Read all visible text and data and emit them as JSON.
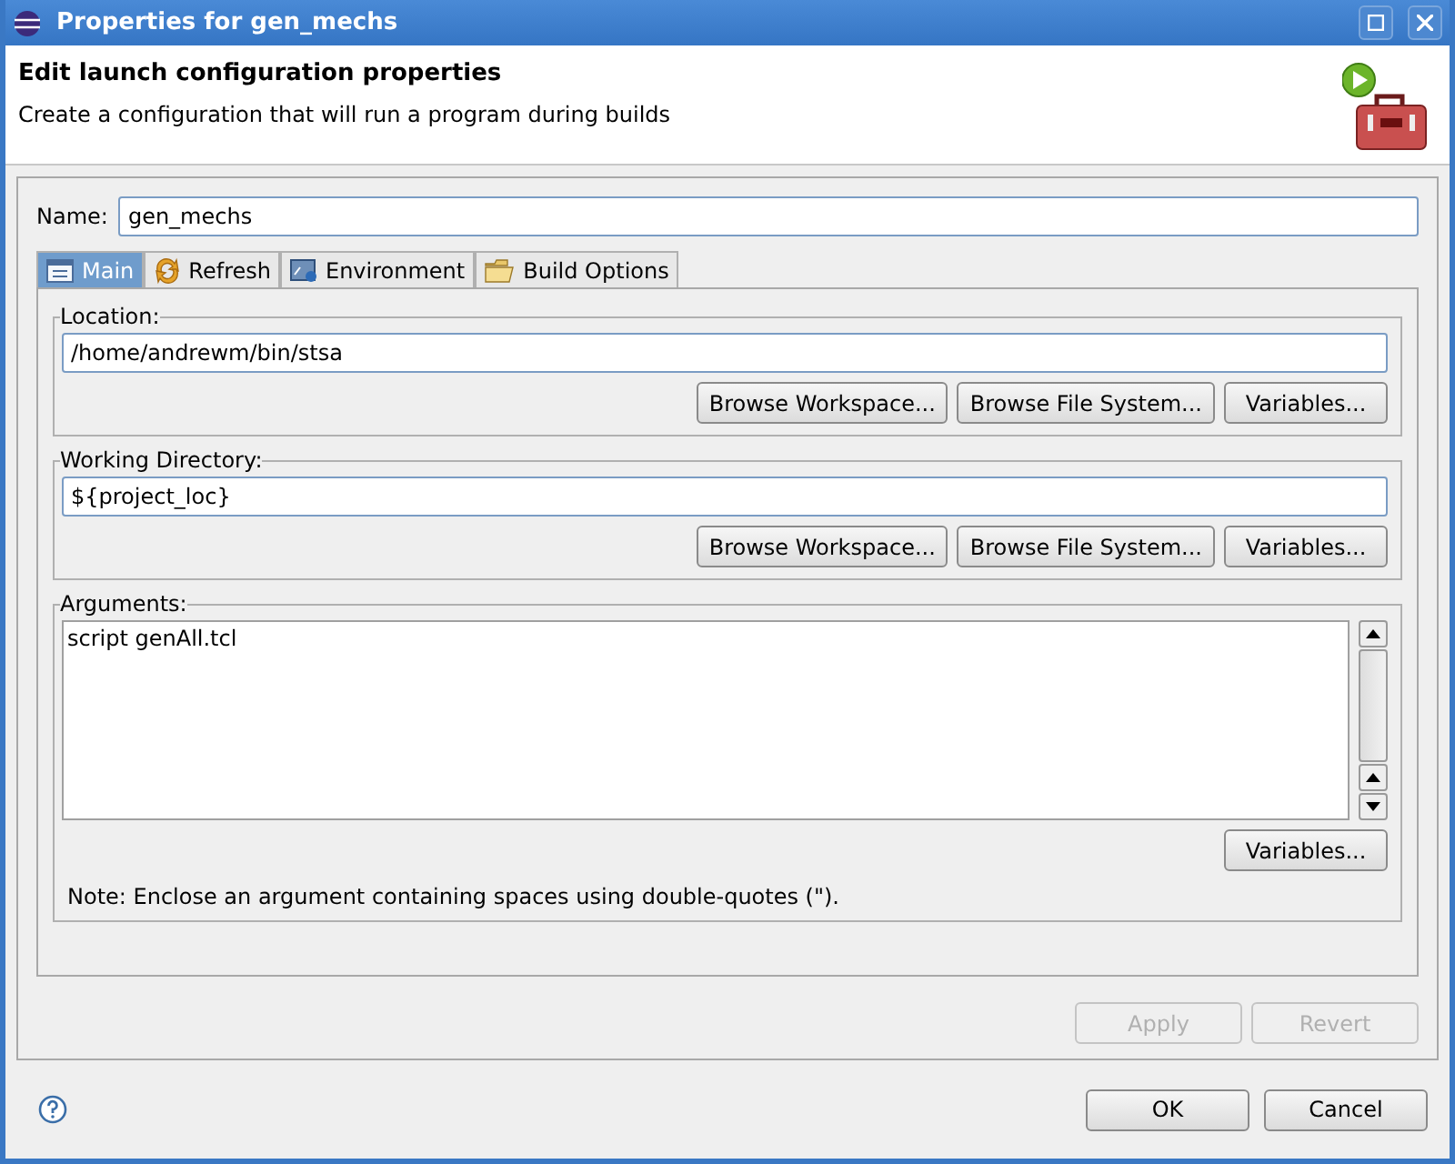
{
  "window": {
    "title": "Properties for gen_mechs"
  },
  "header": {
    "title": "Edit launch configuration properties",
    "description": "Create a configuration that will run a program during builds"
  },
  "name_field": {
    "label": "Name:",
    "value": "gen_mechs"
  },
  "tabs": [
    {
      "label": "Main",
      "kind": "main",
      "selected": true
    },
    {
      "label": "Refresh",
      "kind": "refresh",
      "selected": false
    },
    {
      "label": "Environment",
      "kind": "environment",
      "selected": false
    },
    {
      "label": "Build Options",
      "kind": "build",
      "selected": false
    }
  ],
  "groups": [
    {
      "kind": "single",
      "label": "Location:",
      "value": "/home/andrewm/bin/stsa",
      "buttons": [
        {
          "label": "Browse Workspace..."
        },
        {
          "label": "Browse File System..."
        },
        {
          "label": "Variables..."
        }
      ]
    },
    {
      "kind": "single",
      "label": "Working Directory:",
      "value": "${project_loc}",
      "buttons": [
        {
          "label": "Browse Workspace..."
        },
        {
          "label": "Browse File System..."
        },
        {
          "label": "Variables..."
        }
      ]
    },
    {
      "kind": "multi",
      "label": "Arguments:",
      "value": "script genAll.tcl",
      "buttons": [
        {
          "label": "Variables..."
        }
      ],
      "note": "Note: Enclose an argument containing spaces using double-quotes (\")."
    }
  ],
  "page_buttons": [
    {
      "label": "Apply",
      "disabled": true
    },
    {
      "label": "Revert",
      "disabled": true
    }
  ],
  "dialog_buttons": [
    {
      "label": "OK"
    },
    {
      "label": "Cancel"
    }
  ]
}
